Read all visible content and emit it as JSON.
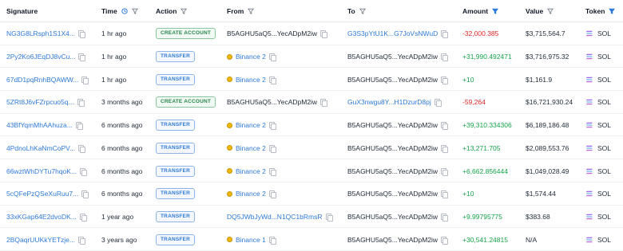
{
  "headers": {
    "signature": "Signature",
    "time": "Time",
    "action": "Action",
    "from": "From",
    "to": "To",
    "amount": "Amount",
    "value": "Value",
    "token": "Token"
  },
  "colors": {
    "accent_blue": "#2f7ad8",
    "negative_red": "#dc2626",
    "positive_green": "#16a34a",
    "create_badge_green": "#27864a",
    "binance_gold": "#f0b90b"
  },
  "rows": [
    {
      "signature": "NG3G8LRsph1S1X4...",
      "time": "1 hr ago",
      "action": "CREATE ACCOUNT",
      "action_type": "create",
      "from": "B5AGHU5aQ5...YecADpM2iw",
      "from_icon": "",
      "from_link": false,
      "to": "G3S3pYtU1K...G7JoVsNWuD",
      "to_link": true,
      "amount": "-32,000.385",
      "amount_sign": "neg",
      "value": "$3,715,564.7",
      "token": "SOL"
    },
    {
      "signature": "2Py2Ko6JEqDJ8vCu...",
      "time": "1 hr ago",
      "action": "TRANSFER",
      "action_type": "transfer",
      "from": "Binance 2",
      "from_icon": "binance-icon",
      "from_link": true,
      "to": "B5AGHU5aQ5...YecADpM2iw",
      "to_link": false,
      "amount": "+31,990.492471",
      "amount_sign": "pos",
      "value": "$3,716,975.32",
      "token": "SOL"
    },
    {
      "signature": "67dD1pqRnhBQAWW...",
      "time": "1 hr ago",
      "action": "TRANSFER",
      "action_type": "transfer",
      "from": "Binance 2",
      "from_icon": "binance-icon",
      "from_link": true,
      "to": "B5AGHU5aQ5...YecADpM2iw",
      "to_link": false,
      "amount": "+10",
      "amount_sign": "pos",
      "value": "$1,161.9",
      "token": "SOL"
    },
    {
      "signature": "5ZRt8J6vFZrpcuo5q...",
      "time": "3 months ago",
      "action": "CREATE ACCOUNT",
      "action_type": "create",
      "from": "B5AGHU5aQ5...YecADpM2iw",
      "from_icon": "",
      "from_link": false,
      "to": "GuX3nwgu8Y...H1DzurD8pj",
      "to_link": true,
      "amount": "-59,264",
      "amount_sign": "neg",
      "value": "$16,721,930.24",
      "token": "SOL"
    },
    {
      "signature": "43BfYqmMhAAhuza...",
      "time": "6 months ago",
      "action": "TRANSFER",
      "action_type": "transfer",
      "from": "Binance 2",
      "from_icon": "binance-icon",
      "from_link": true,
      "to": "B5AGHU5aQ5...YecADpM2iw",
      "to_link": false,
      "amount": "+39,310.334306",
      "amount_sign": "pos",
      "value": "$6,189,186.48",
      "token": "SOL"
    },
    {
      "signature": "4PdnoLhKaNmCoPV...",
      "time": "6 months ago",
      "action": "TRANSFER",
      "action_type": "transfer",
      "from": "Binance 2",
      "from_icon": "binance-icon",
      "from_link": true,
      "to": "B5AGHU5aQ5...YecADpM2iw",
      "to_link": false,
      "amount": "+13,271.705",
      "amount_sign": "pos",
      "value": "$2,089,553.76",
      "token": "SOL"
    },
    {
      "signature": "66wztWhDYTu7hqoK...",
      "time": "6 months ago",
      "action": "TRANSFER",
      "action_type": "transfer",
      "from": "Binance 2",
      "from_icon": "binance-icon",
      "from_link": true,
      "to": "B5AGHU5aQ5...YecADpM2iw",
      "to_link": false,
      "amount": "+6,662.856444",
      "amount_sign": "pos",
      "value": "$1,049,028.49",
      "token": "SOL"
    },
    {
      "signature": "5cQFePzQSeXuRuu7...",
      "time": "6 months ago",
      "action": "TRANSFER",
      "action_type": "transfer",
      "from": "Binance 2",
      "from_icon": "binance-icon",
      "from_link": true,
      "to": "B5AGHU5aQ5...YecADpM2iw",
      "to_link": false,
      "amount": "+10",
      "amount_sign": "pos",
      "value": "$1,574.44",
      "token": "SOL"
    },
    {
      "signature": "33xKGap64E2dvoDK...",
      "time": "1 year ago",
      "action": "TRANSFER",
      "action_type": "transfer",
      "from": "DQ5JWbJyWd...N1QC1bRmsR",
      "from_icon": "",
      "from_link": true,
      "to": "B5AGHU5aQ5...YecADpM2iw",
      "to_link": false,
      "amount": "+9.99795775",
      "amount_sign": "pos",
      "value": "$383.68",
      "token": "SOL"
    },
    {
      "signature": "2BQaqrUUKkYETzje...",
      "time": "3 years ago",
      "action": "TRANSFER",
      "action_type": "transfer",
      "from": "Binance 1",
      "from_icon": "binance-icon",
      "from_link": true,
      "to": "B5AGHU5aQ5...YecADpM2iw",
      "to_link": false,
      "amount": "+30,541.24815",
      "amount_sign": "pos",
      "value": "N/A",
      "token": "SOL"
    }
  ]
}
